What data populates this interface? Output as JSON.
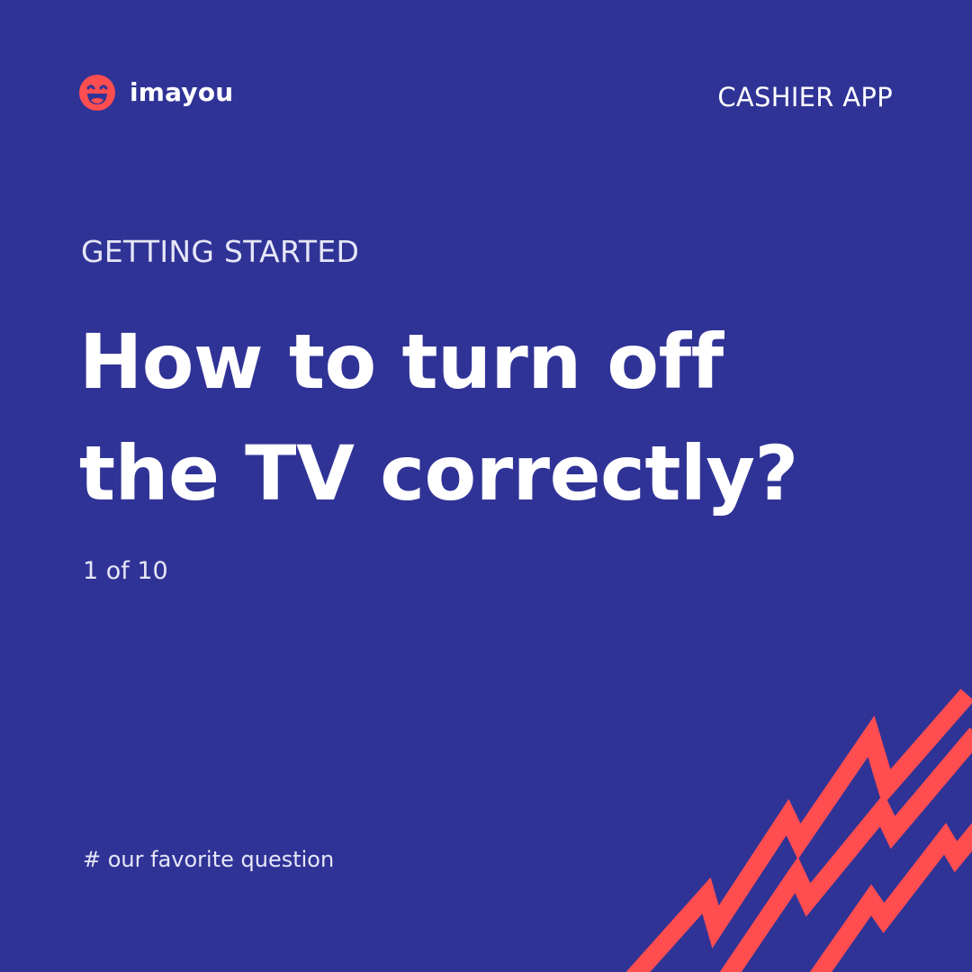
{
  "brand": {
    "name": "imayou",
    "logo_icon": "laughing-face-icon",
    "logo_color": "#ff4d50"
  },
  "header": {
    "app_label": "CASHIER APP"
  },
  "content": {
    "section": "GETTING STARTED",
    "title_line_1": "How to turn off",
    "title_line_2": "the TV correctly?",
    "pager": "1 of 10",
    "hashtag": "# our favorite question"
  },
  "colors": {
    "background": "#303396",
    "accent": "#ff4d50",
    "text": "#ffffff"
  }
}
